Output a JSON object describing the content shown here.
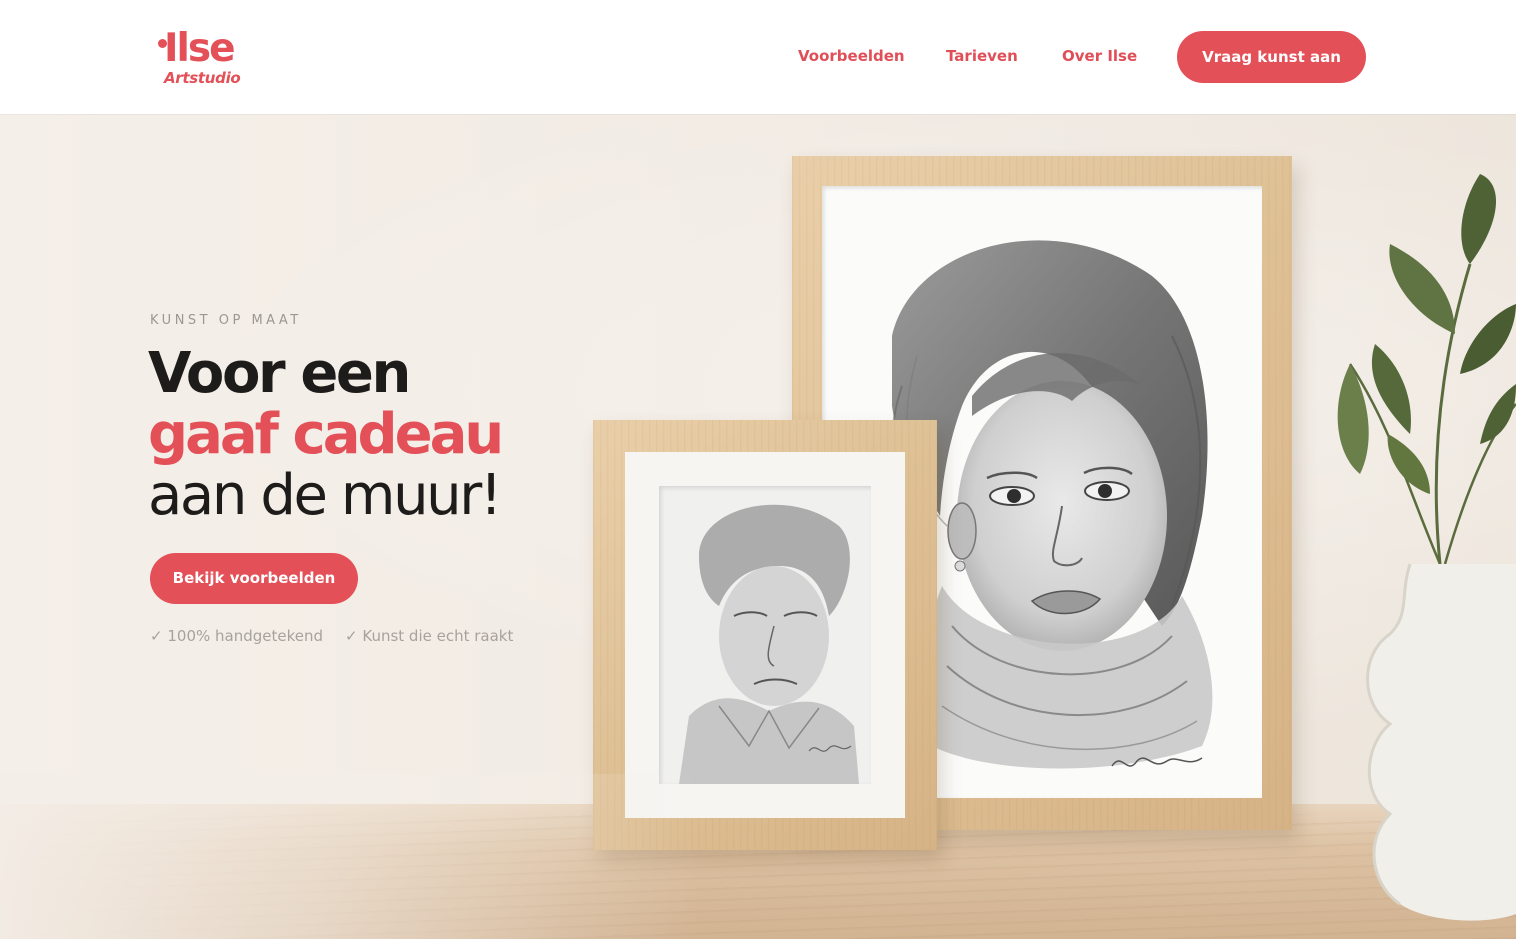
{
  "header": {
    "logo": {
      "name": "Ilse",
      "sub": "Artstudio"
    },
    "nav": [
      {
        "label": "Voorbeelden"
      },
      {
        "label": "Tarieven"
      },
      {
        "label": "Over Ilse"
      }
    ],
    "cta_label": "Vraag kunst aan"
  },
  "hero": {
    "eyebrow": "KUNST OP MAAT",
    "headline": {
      "line1": "Voor een",
      "line2": "gaaf cadeau",
      "line3": "aan de muur!"
    },
    "button_label": "Bekijk voorbeelden",
    "features": [
      {
        "check": "✓",
        "text": "100% handgetekend"
      },
      {
        "check": "✓",
        "text": "Kunst die echt raakt"
      }
    ]
  },
  "colors": {
    "accent": "#e35058",
    "text_dark": "#1d1c1b",
    "muted": "#a8a29c",
    "background": "#f4eee8"
  },
  "icons": [
    "check-icon",
    "logo-dot-icon"
  ]
}
